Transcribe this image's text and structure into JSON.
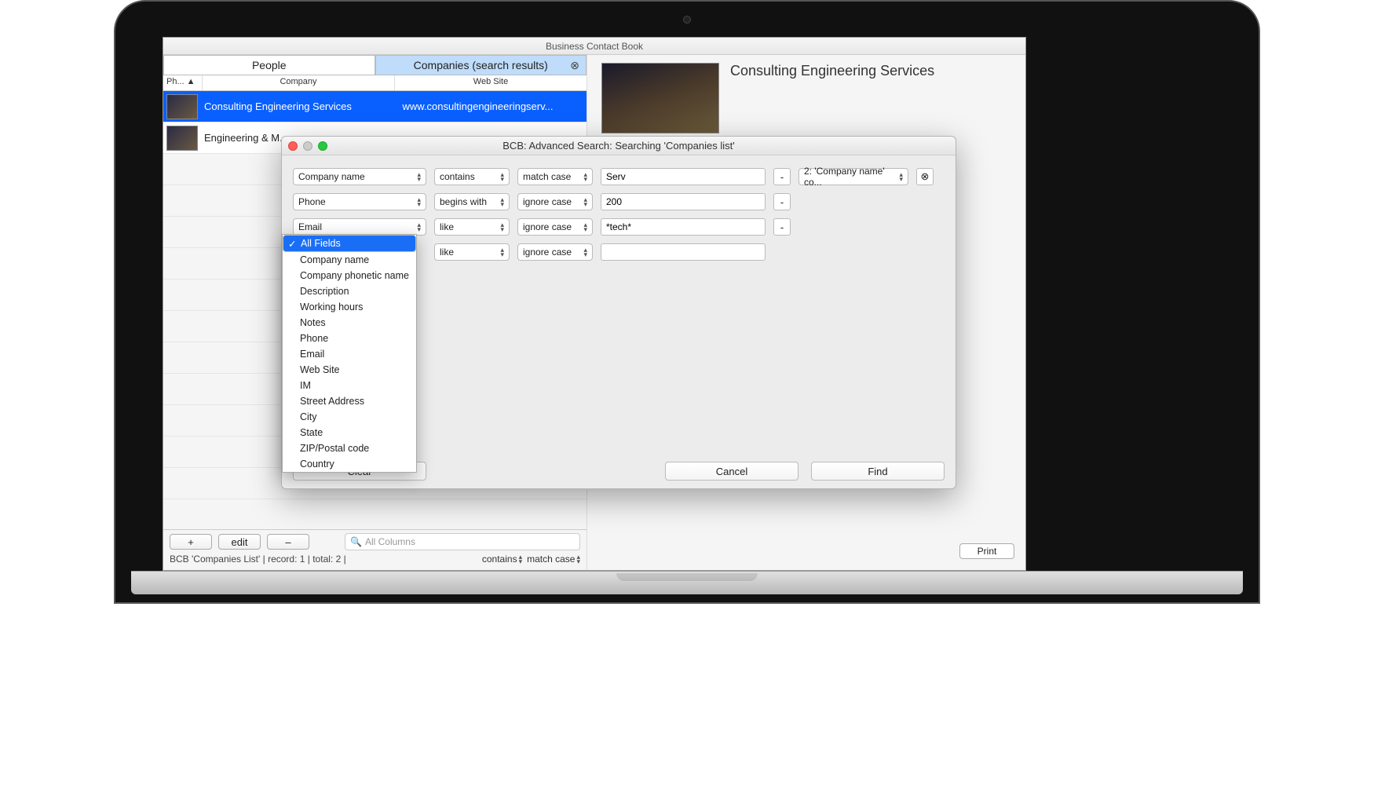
{
  "window_title": "Business Contact Book",
  "tabs": {
    "people": "People",
    "companies": "Companies (search results)"
  },
  "columns": {
    "photo": "Ph... ▲",
    "company": "Company",
    "website": "Web Site"
  },
  "rows": [
    {
      "name": "Consulting Engineering Services",
      "site": "www.consultingengineeringserv...",
      "selected": true
    },
    {
      "name": "Engineering & M...",
      "site": "",
      "selected": false
    }
  ],
  "detail": {
    "title": "Consulting Engineering Services"
  },
  "bottom": {
    "add": "+",
    "edit": "edit",
    "remove": "–",
    "search_placeholder": "All Columns",
    "status": "BCB 'Companies List'  |  record: 1  |  total: 2  |",
    "contains": "contains",
    "matchcase": "match case",
    "print": "Print"
  },
  "modal": {
    "title": "BCB: Advanced Search: Searching 'Companies list'",
    "rows": [
      {
        "field": "Company name",
        "op": "contains",
        "case": "match case",
        "value": "Serv"
      },
      {
        "field": "Phone",
        "op": "begins with",
        "case": "ignore case",
        "value": "200"
      },
      {
        "field": "Email",
        "op": "like",
        "case": "ignore case",
        "value": "*tech*"
      },
      {
        "field": "All Fields",
        "op": "like",
        "case": "ignore case",
        "value": ""
      }
    ],
    "summary": "2: 'Company name' co...",
    "minus": "-",
    "clear_x": "⊗",
    "dropdown": {
      "selected": "All Fields",
      "options": [
        "All Fields",
        "Company name",
        "Company phonetic name",
        "Description",
        "Working hours",
        "Notes",
        "Phone",
        "Email",
        "Web Site",
        "IM",
        "Street Address",
        "City",
        "State",
        "ZIP/Postal code",
        "Country"
      ]
    },
    "buttons": {
      "clear": "Clear",
      "cancel": "Cancel",
      "find": "Find"
    }
  }
}
